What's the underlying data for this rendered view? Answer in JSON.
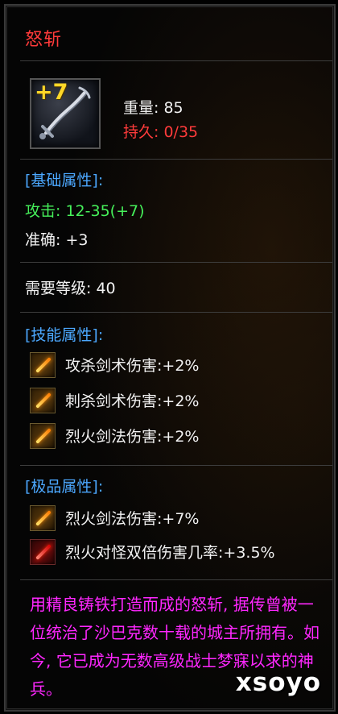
{
  "item": {
    "name": "怒斩",
    "enhance": "+7",
    "weight_label": "重量:",
    "weight_value": "85",
    "durability_label": "持久:",
    "durability_value": "0/35"
  },
  "basic": {
    "header": "[基础属性]:",
    "attack_label": "攻击:",
    "attack_value": "12-35(+7)",
    "accuracy_label": "准确:",
    "accuracy_value": "+3"
  },
  "requirement": {
    "label": "需要等级:",
    "value": "40"
  },
  "skills": {
    "header": "[技能属性]:",
    "items": [
      {
        "text": "攻杀剑术伤害:+2%",
        "icon": "sword-skill-icon"
      },
      {
        "text": "刺杀剑术伤害:+2%",
        "icon": "sword-skill-icon"
      },
      {
        "text": "烈火剑法伤害:+2%",
        "icon": "fire-sword-skill-icon"
      }
    ]
  },
  "extreme": {
    "header": "[极品属性]:",
    "items": [
      {
        "text": "烈火剑法伤害:+7%",
        "icon": "fire-sword-skill-icon"
      },
      {
        "text": "烈火对怪双倍伤害几率:+3.5%",
        "icon": "fire-sword-red-skill-icon"
      }
    ]
  },
  "lore": "用精良铸铁打造而成的怒斩, 据传曾被一位统治了沙巴克数十载的城主所拥有。如今, 它已成为无数高级战士梦寐以求的神兵。",
  "watermark": "xsoyo",
  "colors": {
    "title": "#ff3a3a",
    "section_header": "#4ca8ff",
    "attack": "#46f05a",
    "lore": "#ff27ff",
    "durability": "#ff3b3b",
    "enhance": "#ffd728"
  }
}
